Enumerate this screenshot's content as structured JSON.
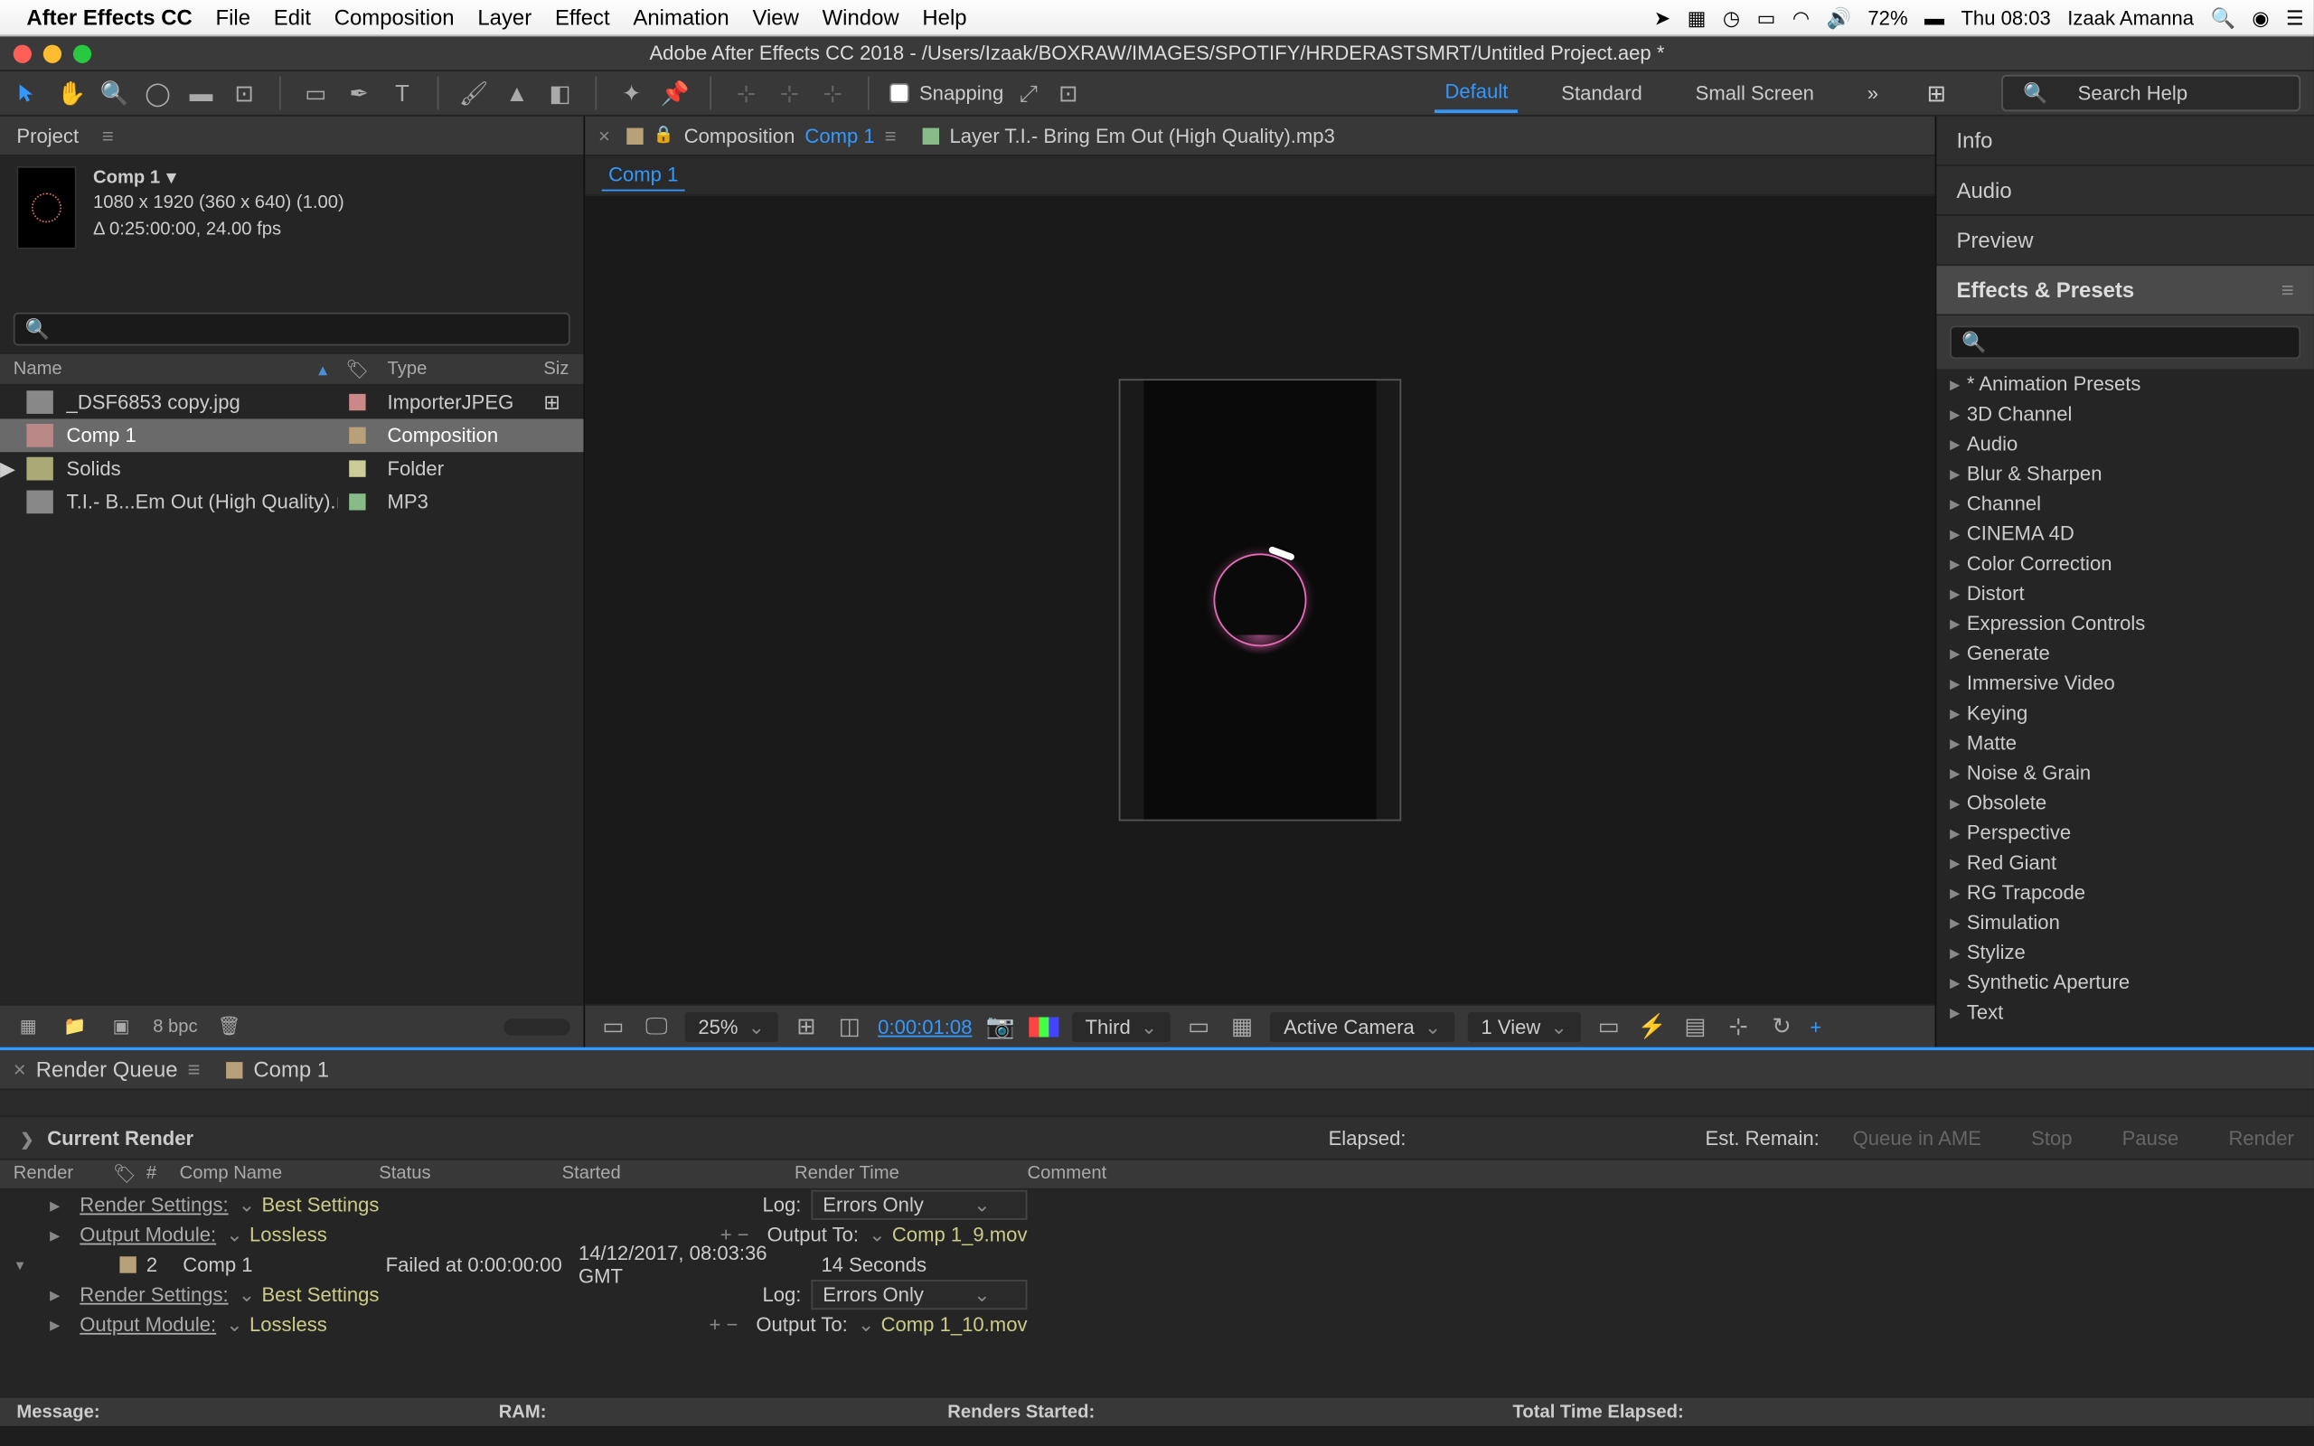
{
  "menubar": {
    "app": "After Effects CC",
    "items": [
      "File",
      "Edit",
      "Composition",
      "Layer",
      "Effect",
      "Animation",
      "View",
      "Window",
      "Help"
    ],
    "battery": "72%",
    "clock": "Thu 08:03",
    "user": "Izaak Amanna"
  },
  "titlebar": {
    "title": "Adobe After Effects CC 2018 - /Users/Izaak/BOXRAW/IMAGES/SPOTIFY/HRDERASTSMRT/Untitled Project.aep *"
  },
  "toolbar": {
    "snapping": "Snapping",
    "workspaces": [
      "Default",
      "Standard",
      "Small Screen"
    ],
    "search_placeholder": "Search Help"
  },
  "project": {
    "title": "Project",
    "comp": {
      "name": "Comp 1",
      "dims": "1080 x 1920  (360 x 640) (1.00)",
      "dur": "Δ 0:25:00:00, 24.00 fps"
    },
    "search_icon": "🔍",
    "cols": {
      "name": "Name",
      "type": "Type",
      "size": "Siz"
    },
    "items": [
      {
        "name": "_DSF6853 copy.jpg",
        "type": "ImporterJPEG",
        "icon": "jpg",
        "label": "pink"
      },
      {
        "name": "Comp 1",
        "type": "Composition",
        "icon": "comp",
        "label": "tan",
        "selected": true
      },
      {
        "name": "Solids",
        "type": "Folder",
        "icon": "folder",
        "label": "yellow",
        "has_children": true
      },
      {
        "name": "T.I.- B...Em Out (High Quality).mp3",
        "type": "MP3",
        "icon": "mp3",
        "label": "green"
      }
    ],
    "footer": {
      "bpc": "8 bpc"
    }
  },
  "composition": {
    "tab_prefix": "Composition",
    "tab_name": "Comp 1",
    "layer_tab": "Layer T.I.- Bring Em Out (High Quality).mp3",
    "flowchart": "Comp 1",
    "footer": {
      "zoom": "25%",
      "time": "0:00:01:08",
      "resolution": "Third",
      "camera": "Active Camera",
      "view": "1 View"
    }
  },
  "right": {
    "sections": [
      "Info",
      "Audio",
      "Preview"
    ],
    "effects_title": "Effects & Presets",
    "effects_search": "🔍",
    "categories": [
      "* Animation Presets",
      "3D Channel",
      "Audio",
      "Blur & Sharpen",
      "Channel",
      "CINEMA 4D",
      "Color Correction",
      "Distort",
      "Expression Controls",
      "Generate",
      "Immersive Video",
      "Keying",
      "Matte",
      "Noise & Grain",
      "Obsolete",
      "Perspective",
      "Red Giant",
      "RG Trapcode",
      "Simulation",
      "Stylize",
      "Synthetic Aperture",
      "Text"
    ]
  },
  "render": {
    "tab": "Render Queue",
    "comp_tab": "Comp 1",
    "current": "Current Render",
    "elapsed": "Elapsed:",
    "remain": "Est. Remain:",
    "buttons": [
      "Queue in AME",
      "Stop",
      "Pause",
      "Render"
    ],
    "cols": [
      "Render",
      "#",
      "Comp Name",
      "Status",
      "Started",
      "Render Time",
      "Comment"
    ],
    "rows": {
      "rs_label": "Render Settings:",
      "rs_value": "Best Settings",
      "log_label": "Log:",
      "log_value": "Errors Only",
      "om_label": "Output Module:",
      "om_value": "Lossless",
      "ot_label": "Output To:",
      "out1": "Comp 1_9.mov",
      "item_num": "2",
      "item_name": "Comp 1",
      "item_status": "Failed at 0:00:00:00",
      "item_started": "14/12/2017, 08:03:36 GMT",
      "item_time": "14 Seconds",
      "out2": "Comp 1_10.mov"
    },
    "status": {
      "message": "Message:",
      "ram": "RAM:",
      "started": "Renders Started:",
      "total": "Total Time Elapsed:"
    }
  }
}
